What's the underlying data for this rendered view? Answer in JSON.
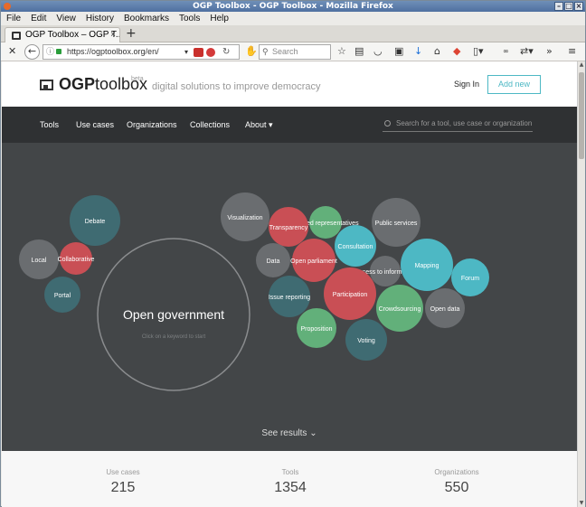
{
  "window": {
    "title": "OGP Toolbox - OGP Toolbox - Mozilla Firefox"
  },
  "menubar": [
    "File",
    "Edit",
    "View",
    "History",
    "Bookmarks",
    "Tools",
    "Help"
  ],
  "tab": {
    "title": "OGP Toolbox – OGP T...",
    "close": "×",
    "new_tab": "+"
  },
  "address": {
    "url": "https://ogptoolbox.org/en/",
    "search_placeholder": "Search"
  },
  "toolbar": {
    "overflow": "»",
    "menu": "≡"
  },
  "site": {
    "logo_bold": "OGP",
    "logo_rest": "toolbox",
    "beta": "beta",
    "tagline": "digital solutions to improve democracy",
    "signin": "Sign In",
    "add_new": "Add new"
  },
  "nav": {
    "items": [
      "Tools",
      "Use cases",
      "Organizations",
      "Collections",
      "About ▾"
    ],
    "search_placeholder": "Search for a tool, use case or organization"
  },
  "colors": {
    "teal": "#3f6b72",
    "red": "#c94f55",
    "gray": "#6a6d70",
    "green": "#62b07a",
    "cyan": "#4db8c4",
    "hero_bg": "#434648",
    "nav_bg": "#2f3133"
  },
  "hero": {
    "center_title": "Open government",
    "center_hint": "Click on a keyword to start",
    "see_results": "See results ⌄"
  },
  "bubbles": [
    {
      "label": "Debate",
      "color": "teal"
    },
    {
      "label": "Local",
      "color": "gray"
    },
    {
      "label": "Collaborative",
      "color": "red"
    },
    {
      "label": "Portal",
      "color": "teal"
    },
    {
      "label": "Visualization",
      "color": "gray"
    },
    {
      "label": "Elected representatives",
      "color": "green"
    },
    {
      "label": "Transparency",
      "color": "red"
    },
    {
      "label": "Public services",
      "color": "gray"
    },
    {
      "label": "Data",
      "color": "gray"
    },
    {
      "label": "Open parliament",
      "color": "red"
    },
    {
      "label": "Consultation",
      "color": "cyan"
    },
    {
      "label": "Access to information",
      "color": "gray"
    },
    {
      "label": "Mapping",
      "color": "cyan"
    },
    {
      "label": "Forum",
      "color": "cyan"
    },
    {
      "label": "Issue reporting",
      "color": "teal"
    },
    {
      "label": "Participation",
      "color": "red"
    },
    {
      "label": "Crowdsourcing",
      "color": "green"
    },
    {
      "label": "Open data",
      "color": "gray"
    },
    {
      "label": "Proposition",
      "color": "green"
    },
    {
      "label": "Voting",
      "color": "teal"
    }
  ],
  "stats": [
    {
      "label": "Use cases",
      "value": "215"
    },
    {
      "label": "Tools",
      "value": "1354"
    },
    {
      "label": "Organizations",
      "value": "550"
    }
  ]
}
